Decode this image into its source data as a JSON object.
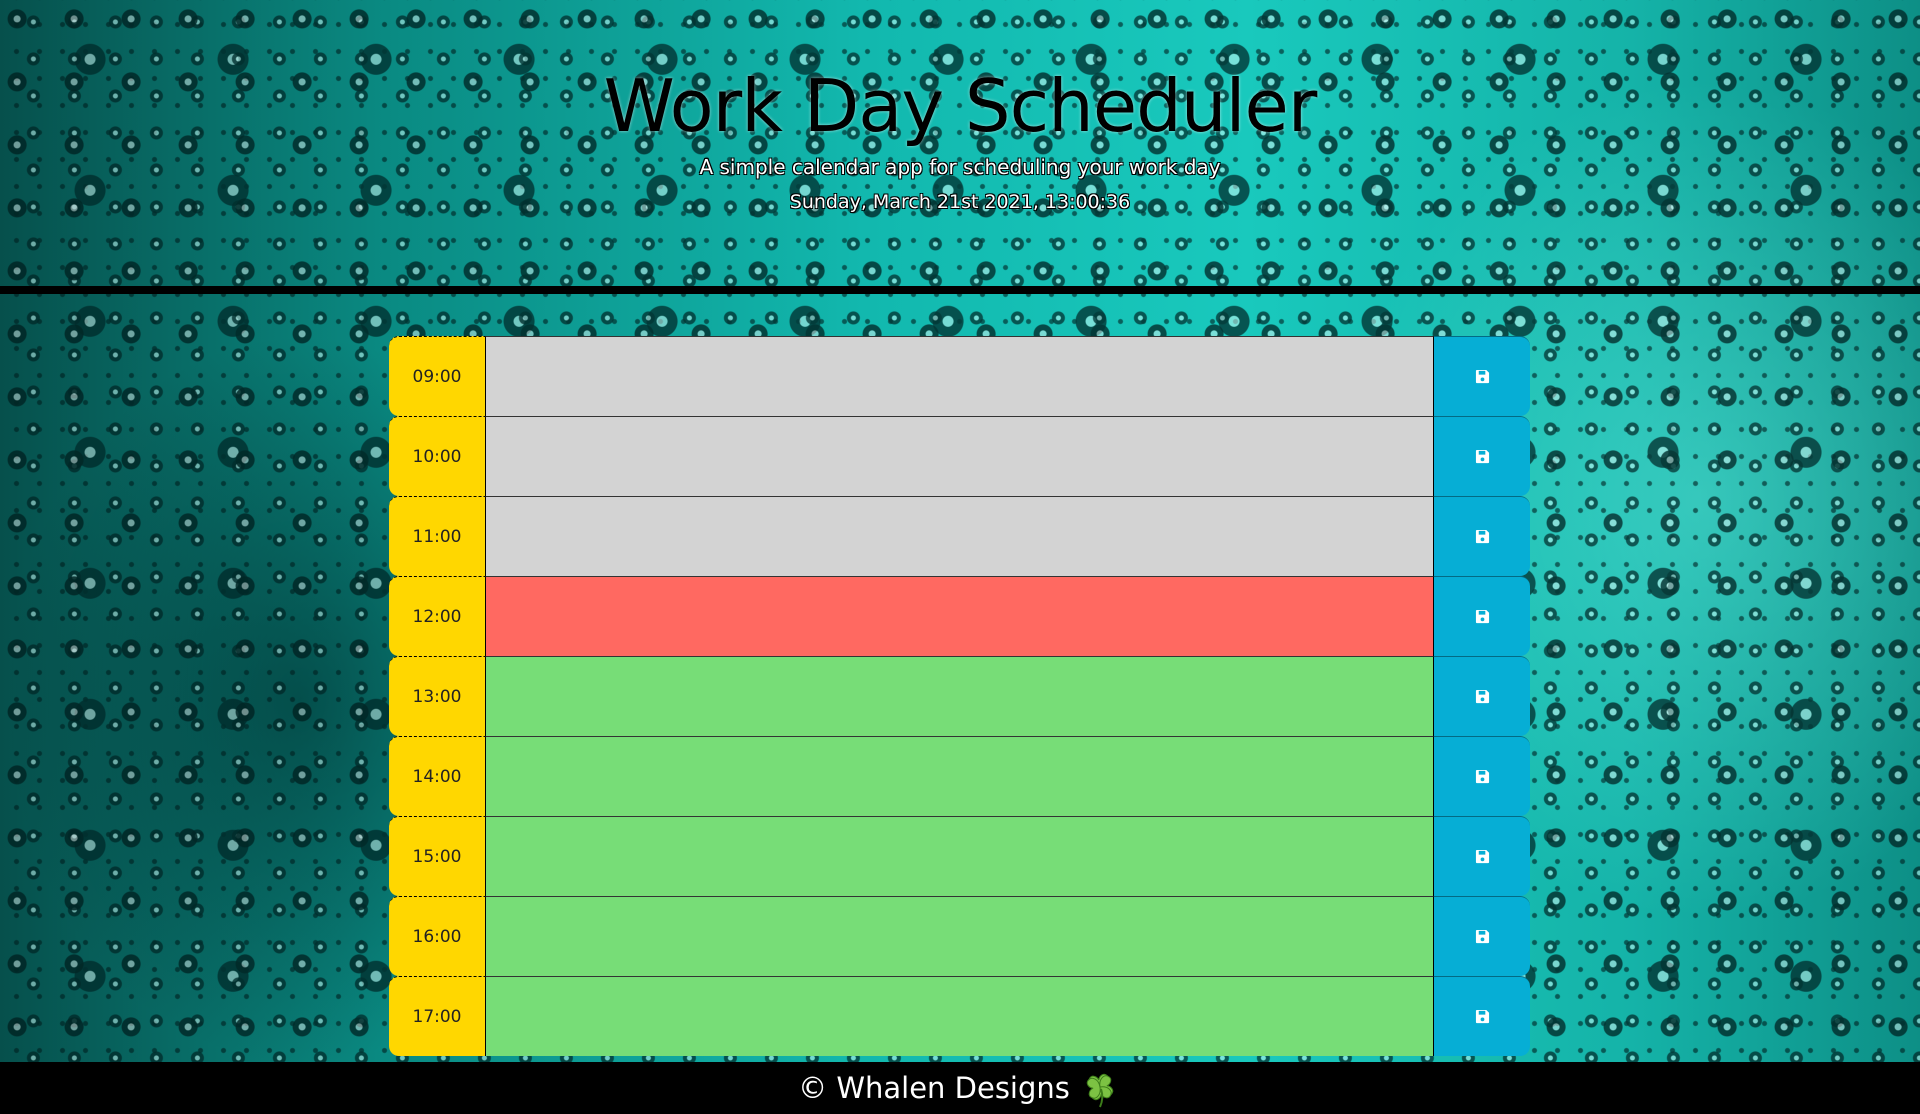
{
  "header": {
    "title": "Work Day Scheduler",
    "subtitle": "A simple calendar app for scheduling your work day",
    "current_day": "Sunday, March 21st 2021, 13:00:36"
  },
  "schedule": {
    "rows": [
      {
        "hour": "09:00",
        "text": "",
        "status": "past"
      },
      {
        "hour": "10:00",
        "text": "",
        "status": "past"
      },
      {
        "hour": "11:00",
        "text": "",
        "status": "past"
      },
      {
        "hour": "12:00",
        "text": "",
        "status": "present"
      },
      {
        "hour": "13:00",
        "text": "",
        "status": "future"
      },
      {
        "hour": "14:00",
        "text": "",
        "status": "future"
      },
      {
        "hour": "15:00",
        "text": "",
        "status": "future"
      },
      {
        "hour": "16:00",
        "text": "",
        "status": "future"
      },
      {
        "hour": "17:00",
        "text": "",
        "status": "future"
      }
    ],
    "save_icon": "floppy-disk-icon"
  },
  "footer": {
    "text": "© Whalen Designs",
    "icon": "four-leaf-clover-icon"
  },
  "colors": {
    "past": "#d3d3d3",
    "present": "#ff6961",
    "future": "#77dd77",
    "hour_block": "#ffd700",
    "save_button": "#06aed5"
  }
}
